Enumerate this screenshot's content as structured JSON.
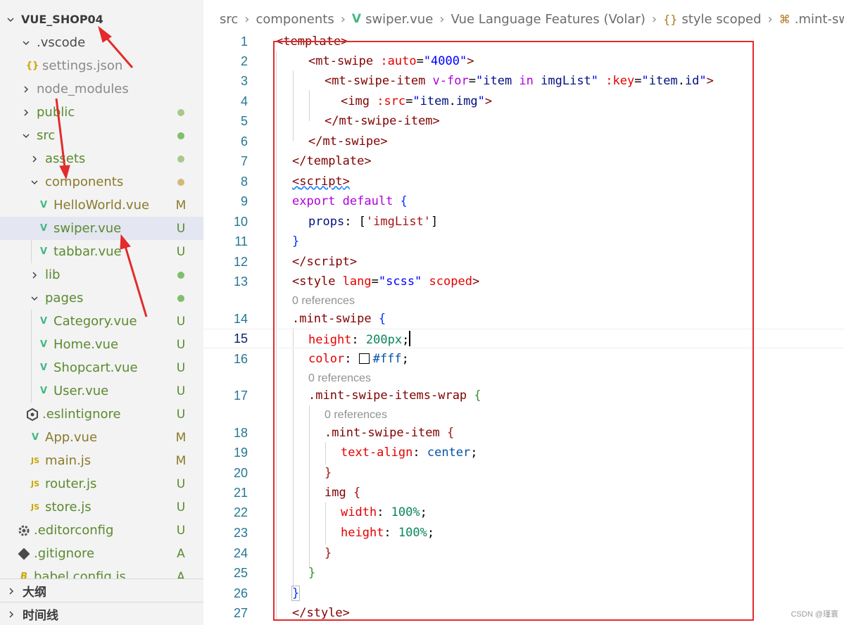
{
  "explorer": {
    "root": "VUE_SHOP04",
    "items": [
      {
        "label": ".vscode",
        "kind": "folder",
        "state": "expanded",
        "badge": "",
        "dot": false
      },
      {
        "label": "settings.json",
        "kind": "json",
        "badge": "",
        "dot": false
      },
      {
        "label": "node_modules",
        "kind": "folder",
        "state": "collapsed",
        "badge": "",
        "dot": false
      },
      {
        "label": "public",
        "kind": "folder",
        "state": "collapsed",
        "badge": "",
        "dot": true
      },
      {
        "label": "src",
        "kind": "folder",
        "state": "expanded",
        "badge": "",
        "dot": true
      },
      {
        "label": "assets",
        "kind": "folder",
        "state": "collapsed",
        "badge": "",
        "dot": true
      },
      {
        "label": "components",
        "kind": "folder",
        "state": "expanded",
        "badge": "",
        "dot": true
      },
      {
        "label": "HelloWorld.vue",
        "kind": "vue",
        "badge": "M",
        "dot": false
      },
      {
        "label": "swiper.vue",
        "kind": "vue",
        "badge": "U",
        "dot": false
      },
      {
        "label": "tabbar.vue",
        "kind": "vue",
        "badge": "U",
        "dot": false
      },
      {
        "label": "lib",
        "kind": "folder",
        "state": "collapsed",
        "badge": "",
        "dot": true
      },
      {
        "label": "pages",
        "kind": "folder",
        "state": "expanded",
        "badge": "",
        "dot": true
      },
      {
        "label": "Category.vue",
        "kind": "vue",
        "badge": "U",
        "dot": false
      },
      {
        "label": "Home.vue",
        "kind": "vue",
        "badge": "U",
        "dot": false
      },
      {
        "label": "Shopcart.vue",
        "kind": "vue",
        "badge": "U",
        "dot": false
      },
      {
        "label": "User.vue",
        "kind": "vue",
        "badge": "U",
        "dot": false
      },
      {
        "label": ".eslintignore",
        "kind": "eslint",
        "badge": "U",
        "dot": false
      },
      {
        "label": "App.vue",
        "kind": "vue",
        "badge": "M",
        "dot": false
      },
      {
        "label": "main.js",
        "kind": "js",
        "badge": "M",
        "dot": false
      },
      {
        "label": "router.js",
        "kind": "js",
        "badge": "U",
        "dot": false
      },
      {
        "label": "store.js",
        "kind": "js",
        "badge": "U",
        "dot": false
      },
      {
        "label": ".editorconfig",
        "kind": "gear",
        "badge": "U",
        "dot": false
      },
      {
        "label": ".gitignore",
        "kind": "git",
        "badge": "A",
        "dot": false
      },
      {
        "label": "babel.config.js",
        "kind": "babel",
        "badge": "A",
        "dot": false
      }
    ]
  },
  "panels": {
    "outline": "大纲",
    "timeline": "时间线"
  },
  "breadcrumb": [
    "src",
    "components",
    "swiper.vue",
    "Vue Language Features (Volar)",
    "style scoped",
    ".mint-swipe"
  ],
  "codelens_text": "0 references",
  "line_numbers": [
    "1",
    "2",
    "3",
    "4",
    "5",
    "6",
    "7",
    "8",
    "9",
    "10",
    "11",
    "12",
    "13",
    "14",
    "15",
    "16",
    "17",
    "18",
    "19",
    "20",
    "21",
    "22",
    "23",
    "24",
    "25",
    "26",
    "27"
  ],
  "code": {
    "l1": {
      "a": "<",
      "b": "template",
      "c": ">"
    },
    "l2": {
      "a": "<",
      "b": "mt-swipe",
      "c": " :auto",
      "d": "=",
      "e": "\"4000\"",
      "f": ">"
    },
    "l3": {
      "a": "<",
      "b": "mt-swipe-item",
      "c": " v-for",
      "d": "=",
      "e": "\"",
      "f": "item",
      "g": " in ",
      "h": "imgList",
      "i": "\"",
      "j": " :key",
      "k": "=",
      "l": "\"",
      "m": "item",
      "n": ".",
      "o": "id",
      "p": "\"",
      "q": ">"
    },
    "l4": {
      "a": "<",
      "b": "img",
      "c": " :src",
      "d": "=",
      "e": "\"",
      "f": "item",
      "g": ".",
      "h": "img",
      "i": "\"",
      "j": ">"
    },
    "l5": {
      "a": "</",
      "b": "mt-swipe-item",
      "c": ">"
    },
    "l6": {
      "a": "</",
      "b": "mt-swipe",
      "c": ">"
    },
    "l7": {
      "a": "</",
      "b": "template",
      "c": ">"
    },
    "l8": {
      "a": "<",
      "b": "script",
      "c": ">"
    },
    "l9": {
      "a": "export",
      "b": " default",
      "c": " {"
    },
    "l10": {
      "a": "props",
      "b": ": [",
      "c": "'imgList'",
      "d": "]"
    },
    "l11": {
      "a": "}"
    },
    "l12": {
      "a": "</",
      "b": "script",
      "c": ">"
    },
    "l13": {
      "a": "<",
      "b": "style",
      "c": " lang",
      "d": "=",
      "e": "\"scss\"",
      "f": " scoped",
      "g": ">"
    },
    "l14": {
      "a": ".mint-swipe",
      "b": " {"
    },
    "l15": {
      "a": "height",
      "b": ": ",
      "c": "200px",
      "d": ";"
    },
    "l16": {
      "a": "color",
      "b": ": ",
      "c": "#fff",
      "d": ";"
    },
    "l17": {
      "a": ".mint-swipe-items-wrap",
      "b": " {"
    },
    "l18": {
      "a": ".mint-swipe-item",
      "b": " {"
    },
    "l19": {
      "a": "text-align",
      "b": ": ",
      "c": "center",
      "d": ";"
    },
    "l20": {
      "a": "}"
    },
    "l21": {
      "a": "img",
      "b": " {"
    },
    "l22": {
      "a": "width",
      "b": ": ",
      "c": "100%",
      "d": ";"
    },
    "l23": {
      "a": "height",
      "b": ": ",
      "c": "100%",
      "d": ";"
    },
    "l24": {
      "a": "}"
    },
    "l25": {
      "a": "}"
    },
    "l26": {
      "a": "}"
    },
    "l27": {
      "a": "</",
      "b": "style",
      "c": ">"
    }
  },
  "watermark": "CSDN @瑾寰",
  "colors": {
    "annotation_red": "#e32b2b",
    "vue_green": "#41b883",
    "selection": "#e4e6f1"
  }
}
